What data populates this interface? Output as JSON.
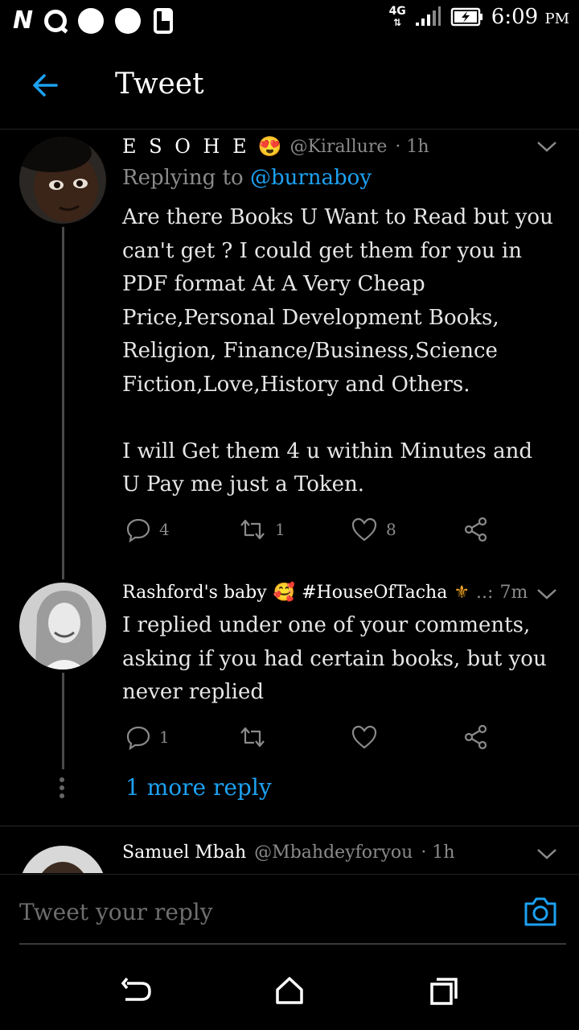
{
  "status_bar": {
    "left_icons": [
      "N",
      "q-icon",
      "circle",
      "circle",
      "screen-icon"
    ],
    "network": "4G",
    "time": "6:09",
    "ampm": "PM"
  },
  "header": {
    "title": "Tweet"
  },
  "tweets": [
    {
      "name": "E S O H E",
      "emoji": "😍",
      "handle": "@Kirallure",
      "time": "· 1h",
      "replying_prefix": "Replying to",
      "replying_to": "@burnaboy",
      "body": "Are there Books U Want to Read but you\ncan't get ? I could get them for you in\nPDF format At A Very Cheap\nPrice,Personal Development Books,\nReligion, Finance/Business,Science\nFiction,Love,History and Others.\n\nI will Get them 4 u within Minutes and\nU Pay me just a Token.",
      "reply_count": "4",
      "retweet_count": "1",
      "like_count": "8"
    },
    {
      "name": "Rashford's baby",
      "emoji": "🥰",
      "hashtag": "#HouseOfTacha",
      "extra": "..:",
      "time": "7m",
      "body": "I replied under one of your comments,\nasking if you had certain books, but you\nnever replied",
      "reply_count": "1",
      "retweet_count": "",
      "like_count": ""
    },
    {
      "name": "Samuel Mbah",
      "handle": "@Mbahdeyforyou",
      "time": "· 1h"
    }
  ],
  "more_reply": "1 more reply",
  "reply_bar": {
    "placeholder": "Tweet your reply"
  },
  "colors": {
    "accent": "#1da1f2",
    "muted": "#8a8a8a",
    "background": "#000000"
  }
}
